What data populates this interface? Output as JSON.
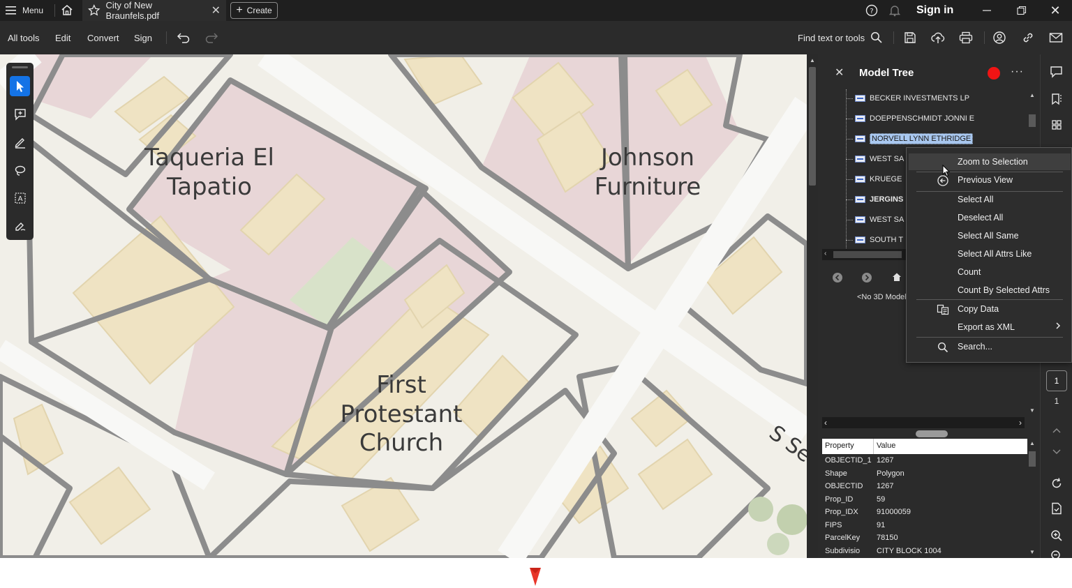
{
  "titlebar": {
    "menu_label": "Menu",
    "tab_title": "City of New Braunfels.pdf",
    "create_label": "Create",
    "signin_label": "Sign in"
  },
  "toolbar": {
    "all_tools": "All tools",
    "edit": "Edit",
    "convert": "Convert",
    "sign": "Sign",
    "find_label": "Find text or tools"
  },
  "map": {
    "labels": {
      "taqueria_1": "Taqueria El",
      "taqueria_2": "Tapatio",
      "johnson_1": "Johnson",
      "johnson_2": "Furniture",
      "church_1": "First",
      "church_2": "Protestant",
      "church_3": "Church",
      "street": "S Se"
    },
    "colors": {
      "road": "#f8f8f6",
      "block_outline": "#8c8c8c",
      "parcel_fill": "#f1efe8",
      "pink_zone": "#e8d6d7",
      "building": "#efe3c3",
      "green_zone": "#d8e2c9"
    }
  },
  "panel": {
    "title": "Model Tree",
    "tree_items": [
      {
        "label": "BECKER INVESTMENTS LP",
        "bold": false,
        "selected": false
      },
      {
        "label": "DOEPPENSCHMIDT JONNI E",
        "bold": false,
        "selected": false
      },
      {
        "label": "NORVELL LYNN ETHRIDGE",
        "bold": false,
        "selected": true
      },
      {
        "label": "WEST SA",
        "bold": false,
        "selected": false
      },
      {
        "label": "KRUEGE",
        "bold": false,
        "selected": false
      },
      {
        "label": "JERGINS",
        "bold": true,
        "selected": false
      },
      {
        "label": "WEST SA",
        "bold": false,
        "selected": false
      },
      {
        "label": "SOUTH T",
        "bold": false,
        "selected": false
      }
    ],
    "no_model_text": "<No 3D Model",
    "properties": {
      "header_property": "Property",
      "header_value": "Value",
      "rows": [
        {
          "property": "OBJECTID_1",
          "value": "1267"
        },
        {
          "property": "Shape",
          "value": "Polygon"
        },
        {
          "property": "OBJECTID",
          "value": "1267"
        },
        {
          "property": "Prop_ID",
          "value": "59"
        },
        {
          "property": "Prop_IDX",
          "value": "91000059"
        },
        {
          "property": "FIPS",
          "value": "91"
        },
        {
          "property": "ParcelKey",
          "value": "78150"
        },
        {
          "property": "Subdivisio",
          "value": "CITY BLOCK 1004"
        }
      ]
    }
  },
  "context_menu": {
    "items": [
      {
        "label": "Zoom to Selection",
        "icon": ""
      },
      {
        "label": "Previous View",
        "icon": "back-circle-icon"
      },
      {
        "label": "Select All",
        "icon": ""
      },
      {
        "label": "Deselect All",
        "icon": ""
      },
      {
        "label": "Select All Same",
        "icon": ""
      },
      {
        "label": "Select All Attrs Like",
        "icon": ""
      },
      {
        "label": "Count",
        "icon": ""
      },
      {
        "label": "Count By Selected Attrs",
        "icon": ""
      },
      {
        "label": "Copy Data",
        "icon": "copy-data-icon"
      },
      {
        "label": "Export as XML",
        "icon": ""
      },
      {
        "label": "Search...",
        "icon": "search-icon"
      }
    ]
  },
  "rail": {
    "current_page": "1",
    "total_pages": "1"
  }
}
